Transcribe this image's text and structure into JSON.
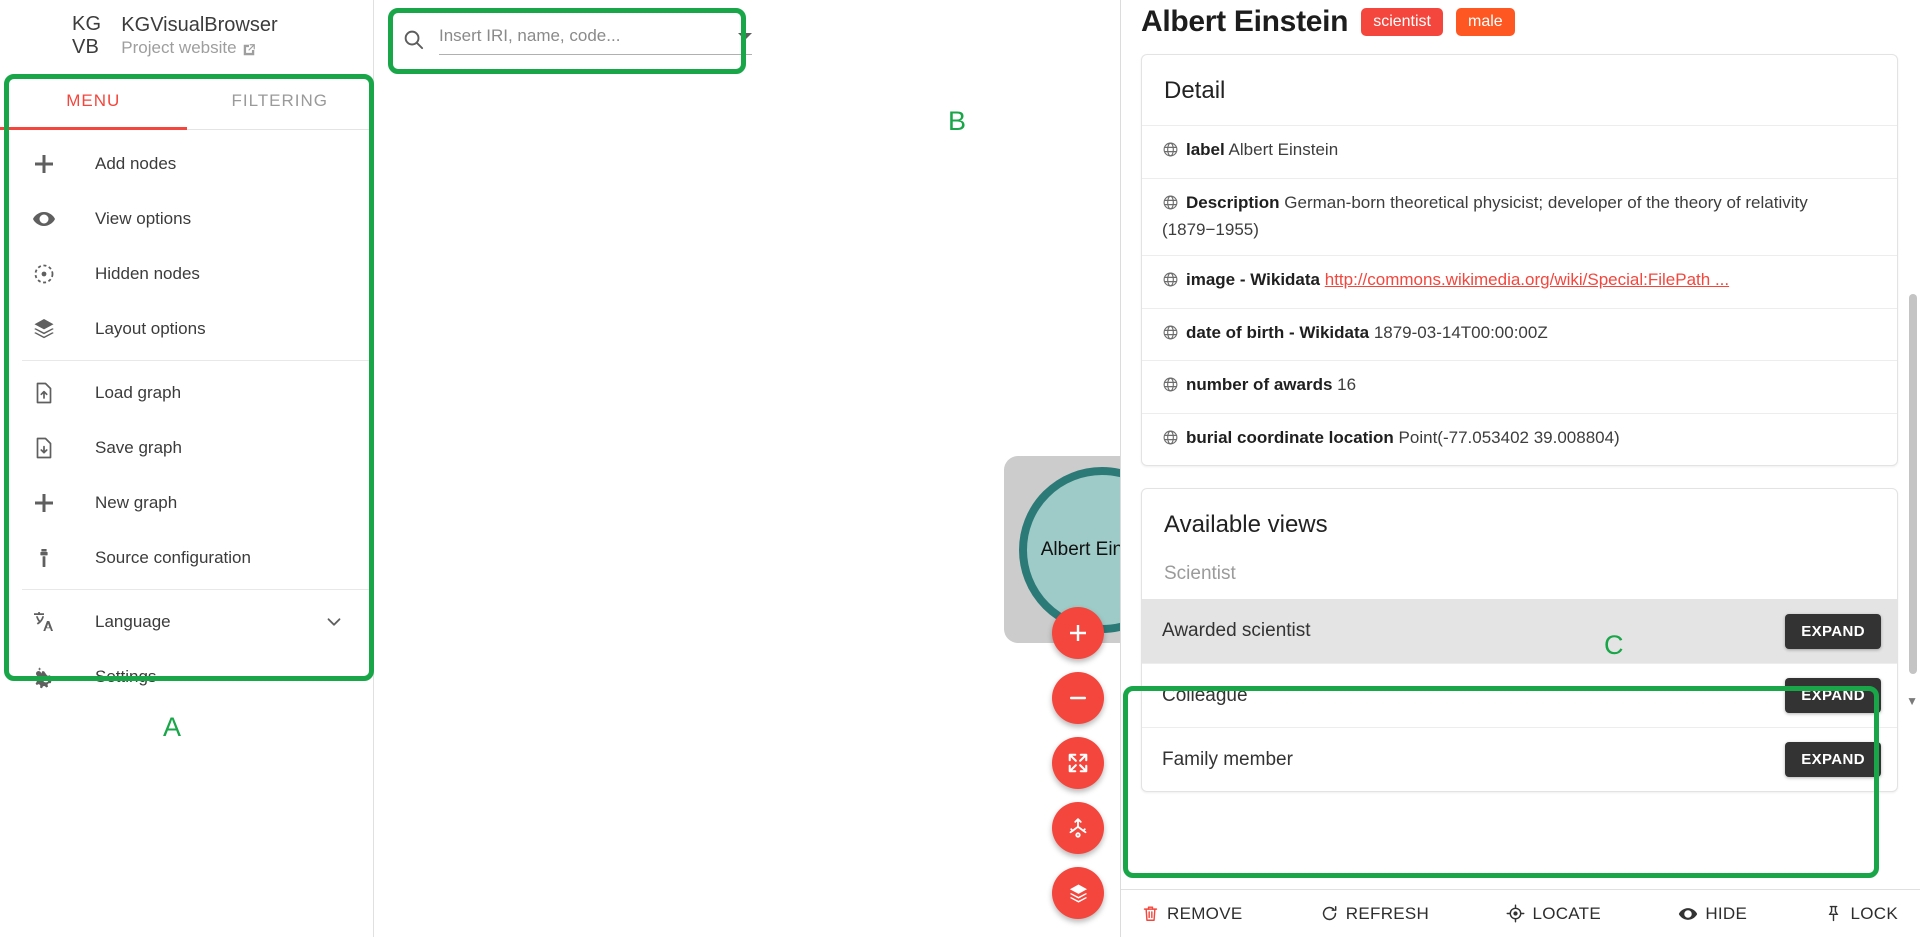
{
  "brand": {
    "abbr_line1": "KG",
    "abbr_line2": "VB",
    "title": "KGVisualBrowser",
    "link_label": "Project website",
    "link_icon": "external-link-icon"
  },
  "tabs": [
    {
      "label": "MENU",
      "active": true
    },
    {
      "label": "FILTERING",
      "active": false
    }
  ],
  "menu": {
    "items": [
      {
        "label": "Add nodes",
        "icon": "plus-icon"
      },
      {
        "label": "View options",
        "icon": "eye-icon"
      },
      {
        "label": "Hidden nodes",
        "icon": "hidden-node-icon"
      },
      {
        "label": "Layout options",
        "icon": "layers-icon"
      },
      {
        "label": "Load graph",
        "icon": "file-upload-icon"
      },
      {
        "label": "Save graph",
        "icon": "file-download-icon"
      },
      {
        "label": "New graph",
        "icon": "plus-icon"
      },
      {
        "label": "Source configuration",
        "icon": "source-config-icon"
      },
      {
        "label": "Language",
        "icon": "translate-icon",
        "chevron": "chevron-down-icon"
      },
      {
        "label": "Settings",
        "icon": "settings-gear-icon"
      }
    ]
  },
  "search": {
    "placeholder": "Insert IRI, name, code...",
    "value": "",
    "icon": "search-icon",
    "dropdown_icon": "chevron-down-icon"
  },
  "graph": {
    "node_label": "Albert Einstein",
    "node_fill": "#9ecbc7",
    "node_stroke": "#2c7a78",
    "node_box": "#cccccc"
  },
  "fabs": [
    {
      "name": "zoom-in",
      "icon": "plus-icon"
    },
    {
      "name": "zoom-out",
      "icon": "minus-icon"
    },
    {
      "name": "fit-to-screen",
      "icon": "expand-arrows-icon"
    },
    {
      "name": "rearrange",
      "icon": "shuffle-icon"
    },
    {
      "name": "layers",
      "icon": "layers-icon"
    }
  ],
  "detail": {
    "title": "Albert Einstein",
    "badges": [
      {
        "label": "scientist",
        "color": "#f4463c"
      },
      {
        "label": "male",
        "color": "#ff5722"
      }
    ],
    "card_title": "Detail",
    "properties": [
      {
        "key": "label",
        "value": "Albert Einstein",
        "icon": "globe-icon",
        "is_link": false
      },
      {
        "key": "Description",
        "value": "German-born theoretical physicist; developer of the theory of relativity (1879−1955)",
        "icon": "globe-icon",
        "is_link": false
      },
      {
        "key": "image - Wikidata",
        "value": "http://commons.wikimedia.org/wiki/Special:FilePath ...",
        "icon": "globe-icon",
        "is_link": true
      },
      {
        "key": "date of birth - Wikidata",
        "value": "1879-03-14T00:00:00Z",
        "icon": "globe-icon",
        "is_link": false
      },
      {
        "key": "number of awards",
        "value": "16",
        "icon": "globe-icon",
        "is_link": false
      },
      {
        "key": "burial coordinate location",
        "value": "Point(-77.053402 39.008804)",
        "icon": "globe-icon",
        "is_link": false
      }
    ],
    "views_title": "Available views",
    "views_group": "Scientist",
    "views": [
      {
        "name": "Awarded scientist",
        "button": "EXPAND",
        "selected": true
      },
      {
        "name": "Colleague",
        "button": "EXPAND",
        "selected": false
      },
      {
        "name": "Family member",
        "button": "EXPAND",
        "selected": false
      }
    ],
    "footer": [
      {
        "label": "REMOVE",
        "icon": "trash-icon",
        "danger": true
      },
      {
        "label": "REFRESH",
        "icon": "refresh-icon",
        "danger": false
      },
      {
        "label": "LOCATE",
        "icon": "locate-icon",
        "danger": false
      },
      {
        "label": "HIDE",
        "icon": "eye-icon",
        "danger": false
      },
      {
        "label": "LOCK",
        "icon": "pin-icon",
        "danger": false
      }
    ]
  },
  "annotations": [
    {
      "letter": "A"
    },
    {
      "letter": "B"
    },
    {
      "letter": "C"
    }
  ]
}
